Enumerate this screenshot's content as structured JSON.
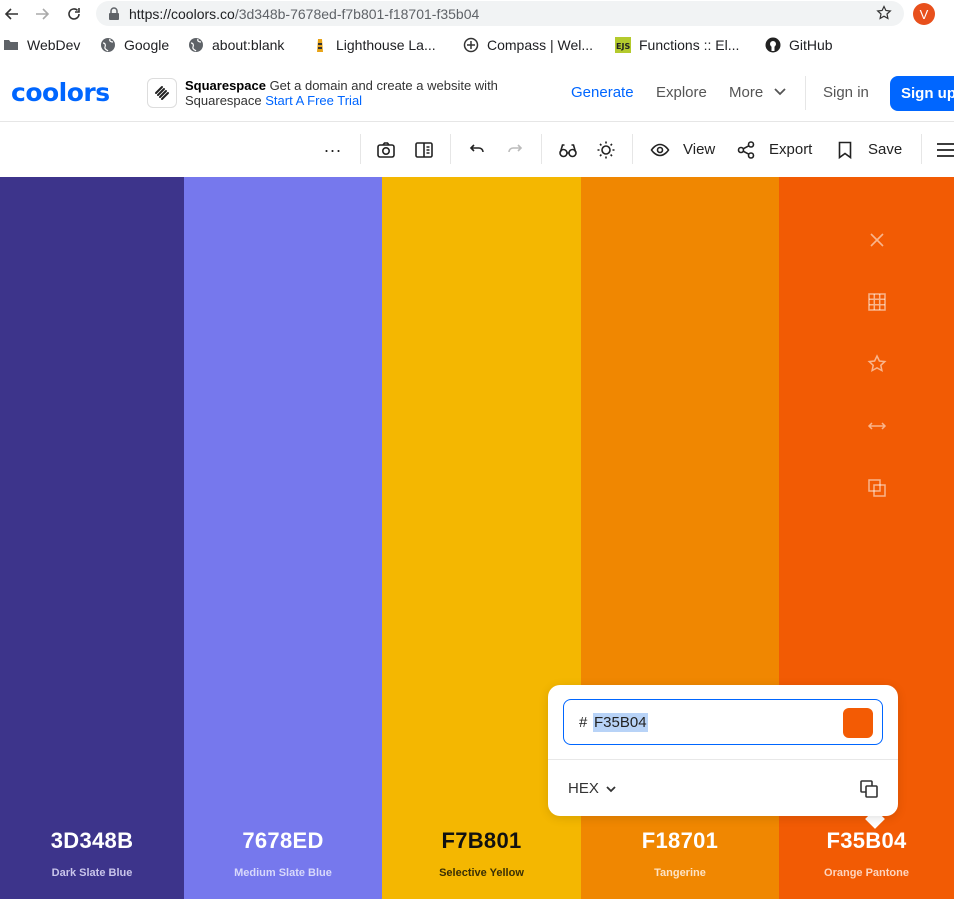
{
  "browser": {
    "url_host": "https://coolors.co",
    "url_path": "/3d348b-7678ed-f7b801-f18701-f35b04",
    "profile_initial": "V"
  },
  "bookmarks": [
    "WebDev",
    "Google",
    "about:blank",
    "Lighthouse La...",
    "Compass | Wel...",
    "Functions :: El...",
    "GitHub"
  ],
  "header": {
    "logo": "coolors",
    "ad_title": "Squarespace",
    "ad_body": "Get a domain and create a website with",
    "ad_brand": "Squarespace",
    "ad_cta": "Start A Free Trial",
    "nav": [
      "Generate",
      "Explore",
      "More"
    ],
    "sign_in": "Sign in",
    "sign_up": "Sign up"
  },
  "toolbar": {
    "more": "...",
    "view": "View",
    "export": "Export",
    "save": "Save"
  },
  "palette": [
    {
      "hex": "3D348B",
      "name": "Dark Slate Blue",
      "color": "#3d348b",
      "text_color": "#ffffff",
      "name_color": "#c9c5ea"
    },
    {
      "hex": "7678ED",
      "name": "Medium Slate Blue",
      "color": "#7678ed",
      "text_color": "#ffffff",
      "name_color": "#d8d9fb"
    },
    {
      "hex": "F7B801",
      "name": "Selective Yellow",
      "color": "#f4b701",
      "text_color": "#111111",
      "name_color": "#3a2f05"
    },
    {
      "hex": "F18701",
      "name": "Tangerine",
      "color": "#f08701",
      "text_color": "#ffffff",
      "name_color": "#fde3c5"
    },
    {
      "hex": "F35B04",
      "name": "Orange Pantone",
      "color": "#f25b04",
      "text_color": "#ffffff",
      "name_color": "#fdd5bf"
    }
  ],
  "picker": {
    "hash": "#",
    "value": "F35B04",
    "mode": "HEX",
    "swatch_color": "#f35b04"
  }
}
